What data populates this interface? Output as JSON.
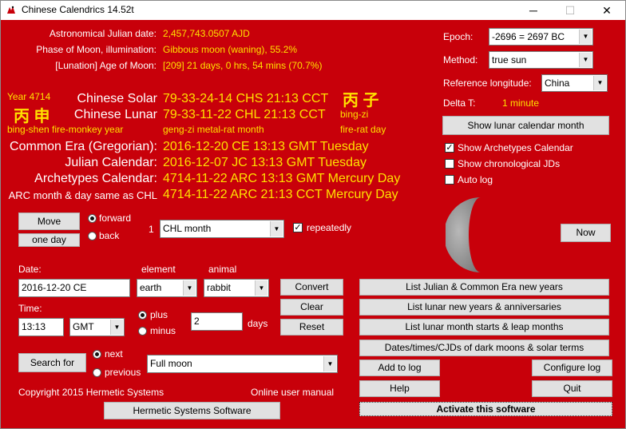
{
  "window": {
    "title": "Chinese Calendrics 14.52t",
    "controls": [
      "─",
      "☐",
      "✕"
    ]
  },
  "astro": [
    {
      "label": "Astronomical Julian date:",
      "value": "2,457,743.0507 AJD"
    },
    {
      "label": "Phase of Moon, illumination:",
      "value": "Gibbous moon (waning), 55.2%"
    },
    {
      "label": "[Lunation] Age of Moon:",
      "value": "[209] 21 days, 0 hrs, 54 mins (70.7%)"
    }
  ],
  "year_block": {
    "year": "Year 4714",
    "chars": "丙 申",
    "pinyin": "bing-shen fire-monkey year"
  },
  "day_block": {
    "chars": "丙 子",
    "pinyin": "bing-zi",
    "element": "fire-rat day"
  },
  "chinese_solar": {
    "label": "Chinese Solar",
    "value": "79-33-24-14 CHS 21:13 CCT"
  },
  "chinese_lunar": {
    "label": "Chinese Lunar",
    "value": "79-33-11-22 CHL 21:13 CCT",
    "month": "geng-zi metal-rat month"
  },
  "calendars": [
    {
      "label": "Common Era (Gregorian):",
      "value": "2016-12-20 CE 13:13 GMT Tuesday"
    },
    {
      "label": "Julian Calendar:",
      "value": "2016-12-07 JC 13:13 GMT Tuesday"
    },
    {
      "label": "Archetypes Calendar:",
      "value": "4714-11-22 ARC 13:13 GMT Mercury Day"
    },
    {
      "label": "ARC month & day same as CHL",
      "value": "4714-11-22 ARC 21:13 CCT Mercury Day"
    }
  ],
  "settings": {
    "epoch_label": "Epoch:",
    "epoch_value": "-2696 = 2697 BC",
    "method_label": "Method:",
    "method_value": "true sun",
    "ref_long_label": "Reference longitude:",
    "ref_long_value": "China",
    "delta_t_label": "Delta T:",
    "delta_t_value": "1 minute",
    "show_lunar_month": "Show lunar calendar month",
    "show_archetypes": "Show Archetypes Calendar",
    "show_chrono": "Show chronological JDs",
    "auto_log": "Auto log"
  },
  "move": {
    "move_label": "Move",
    "one_day": "one day",
    "forward": "forward",
    "back": "back",
    "count": "1",
    "unit": "CHL month",
    "repeatedly": "repeatedly"
  },
  "now_label": "Now",
  "date_panel": {
    "date_label": "Date:",
    "element_label": "element",
    "animal_label": "animal",
    "date_value": "2016-12-20 CE",
    "element_value": "earth",
    "animal_value": "rabbit",
    "time_label": "Time:",
    "time_value": "13:13",
    "tz_value": "GMT",
    "plus": "plus",
    "minus": "minus",
    "days_value": "2",
    "days_label": "days",
    "convert": "Convert",
    "clear": "Clear",
    "reset": "Reset"
  },
  "search": {
    "button": "Search for",
    "next": "next",
    "previous": "previous",
    "target": "Full moon"
  },
  "footer": {
    "copyright": "Copyright 2015  Hermetic Systems",
    "manual": "Online user manual",
    "hermetic_button": "Hermetic Systems Software"
  },
  "lists": {
    "julian_ce": "List Julian & Common Era new years",
    "lunar_new_years": "List lunar new years & anniversaries",
    "lunar_months": "List lunar month starts & leap months",
    "dark_moons": "Dates/times/CJDs of dark moons & solar terms",
    "add_log": "Add to log",
    "configure_log": "Configure log",
    "help": "Help",
    "quit": "Quit",
    "activate": "Activate this software"
  },
  "icons": {
    "app": "dragon-icon",
    "check": "✓",
    "arrow": "▼"
  },
  "colors": {
    "background": "#c8000a",
    "value": "#ffe000",
    "label": "#ffffff"
  }
}
